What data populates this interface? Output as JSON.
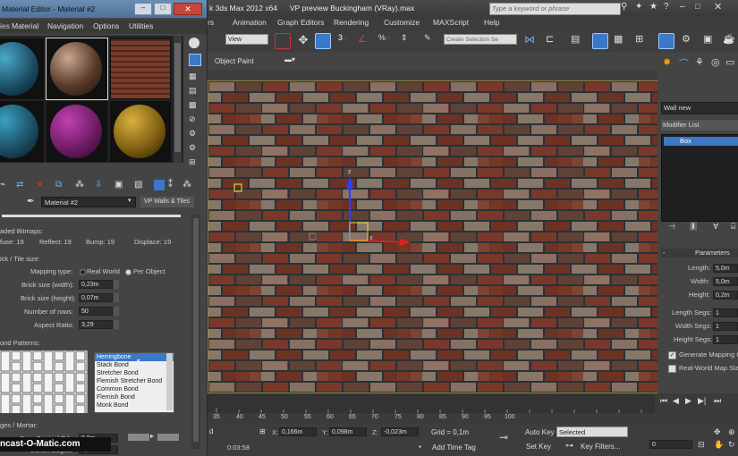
{
  "main_window": {
    "title": "3ds Max  2012 x64      VP preview Buckingham (VRay).max",
    "title_prefix_fragment": "k 3ds Max  2012 x64",
    "title_file": "VP preview Buckingham (VRay).max",
    "search_placeholder": "Type a keyword or phrase",
    "menu": [
      "rs",
      "Animation",
      "Graph Editors",
      "Rendering",
      "Customize",
      "MAXScript",
      "Help"
    ],
    "view_dropdown": "View",
    "selection_set": "Create Selection Se",
    "viewport_label": "Object Paint"
  },
  "command_panel": {
    "object_name": "Wall new",
    "modifier_list": "Modifier List",
    "stack_item": "Box",
    "rollout_title": "Parameters",
    "params": [
      {
        "label": "Length:",
        "value": "5,0m"
      },
      {
        "label": "Width:",
        "value": "5,0m"
      },
      {
        "label": "Height:",
        "value": "0,2m"
      },
      {
        "label": "Length Segs:",
        "value": "1"
      },
      {
        "label": "Width Segs:",
        "value": "1"
      },
      {
        "label": "Height Segs:",
        "value": "1"
      }
    ],
    "gen_mapping": "Generate Mapping C",
    "real_world": "Real-World Map Siz"
  },
  "timeline": {
    "ticks": [
      "35",
      "40",
      "45",
      "50",
      "55",
      "60",
      "65",
      "70",
      "75",
      "80",
      "85",
      "90",
      "95",
      "100"
    ]
  },
  "status": {
    "time": "0:03:58",
    "x_label": "X:",
    "x_value": "0,166m",
    "y_label": "Y:",
    "y_value": "0,098m",
    "z_label": "Z:",
    "z_value": "-0,023m",
    "grid": "Grid = 0,1m",
    "add_time_tag": "Add Time Tag",
    "auto_key": "Auto Key",
    "set_key": "Set Key",
    "selected": "Selected",
    "key_filters": "Key Filters...",
    "frame": "0"
  },
  "material_editor": {
    "title": "Material Editor - Material #2",
    "menu": [
      "Material",
      "Navigation",
      "Options",
      "Utilities"
    ],
    "menu_prefix": "ies",
    "material_name": "Material #2",
    "material_type": "VP Walls & Tiles",
    "loaded_bitmaps_header": "aded Bitmaps:",
    "bitmap_stats": {
      "diffuse": "fuse: 19",
      "reflect": "Reflect: 19",
      "bump": "Bump: 19",
      "displace": "Displace: 19"
    },
    "brick_size_header": "ick / Tile size:",
    "mapping_type_label": "Mapping type:",
    "mapping_options": [
      "Real World",
      "Per Object"
    ],
    "mapping_selected": "Per Object",
    "brick_width_label": "Brick size (width):",
    "brick_width": "0,23m",
    "brick_height_label": "Brick size (height):",
    "brick_height": "0,07m",
    "rows_label": "Number of rows:",
    "rows": "50",
    "aspect_label": "Aspect Ratio:",
    "aspect": "3,29",
    "bond_header": "ond Patterns:",
    "bond_patterns": [
      "Herringbone",
      "Stack Bond",
      "Stretcher Bond",
      "Flemish Stretcher Bond",
      "Common Bond",
      "Flemish Bond",
      "Monk Bond"
    ],
    "bond_selected": "Herringbone",
    "edges_header": "ges / Mortar:",
    "crop_label": "Crop Original Edges:",
    "crop_value": "0,0m",
    "soften_label": "Soften Edges:",
    "soften_value": "0,0m",
    "watermark": "ncast-O-Matic.com"
  },
  "colors": {
    "accent_blue": "#3a78c8",
    "brick": "#7a3b28",
    "panel": "#444444"
  }
}
